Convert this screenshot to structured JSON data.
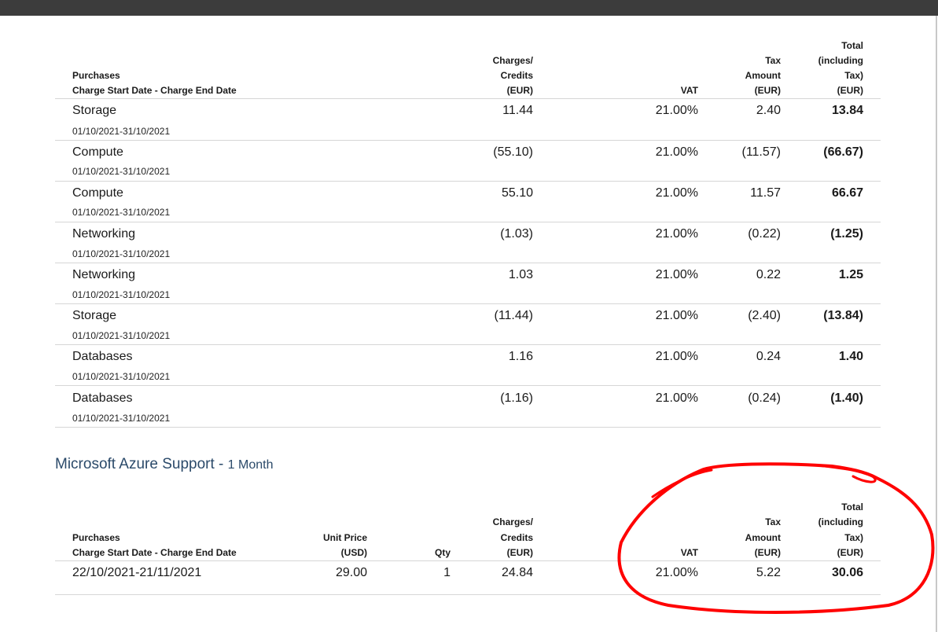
{
  "table1": {
    "headers": {
      "purchases": "Purchases",
      "dates": "Charge Start Date - Charge End Date",
      "charges": [
        "Charges/",
        "Credits",
        "(EUR)"
      ],
      "vat": "VAT",
      "tax": [
        "Tax",
        "Amount",
        "(EUR)"
      ],
      "total": [
        "Total",
        "(including",
        "Tax)",
        "(EUR)"
      ]
    },
    "rows": [
      {
        "name": "Storage",
        "dates": "01/10/2021-31/10/2021",
        "charges": "11.44",
        "vat": "21.00%",
        "tax": "2.40",
        "total": "13.84"
      },
      {
        "name": "Compute",
        "dates": "01/10/2021-31/10/2021",
        "charges": "(55.10)",
        "vat": "21.00%",
        "tax": "(11.57)",
        "total": "(66.67)"
      },
      {
        "name": "Compute",
        "dates": "01/10/2021-31/10/2021",
        "charges": "55.10",
        "vat": "21.00%",
        "tax": "11.57",
        "total": "66.67"
      },
      {
        "name": "Networking",
        "dates": "01/10/2021-31/10/2021",
        "charges": "(1.03)",
        "vat": "21.00%",
        "tax": "(0.22)",
        "total": "(1.25)"
      },
      {
        "name": "Networking",
        "dates": "01/10/2021-31/10/2021",
        "charges": "1.03",
        "vat": "21.00%",
        "tax": "0.22",
        "total": "1.25"
      },
      {
        "name": "Storage",
        "dates": "01/10/2021-31/10/2021",
        "charges": "(11.44)",
        "vat": "21.00%",
        "tax": "(2.40)",
        "total": "(13.84)"
      },
      {
        "name": "Databases",
        "dates": "01/10/2021-31/10/2021",
        "charges": "1.16",
        "vat": "21.00%",
        "tax": "0.24",
        "total": "1.40"
      },
      {
        "name": "Databases",
        "dates": "01/10/2021-31/10/2021",
        "charges": "(1.16)",
        "vat": "21.00%",
        "tax": "(0.24)",
        "total": "(1.40)"
      }
    ]
  },
  "section2": {
    "title": "Microsoft Azure Support",
    "separator": " - ",
    "subtitle": "1 Month"
  },
  "table2": {
    "headers": {
      "purchases": "Purchases",
      "dates": "Charge Start Date - Charge End Date",
      "unit_price": [
        "Unit Price",
        "(USD)"
      ],
      "qty": "Qty",
      "charges": [
        "Charges/",
        "Credits",
        "(EUR)"
      ],
      "vat": "VAT",
      "tax": [
        "Tax",
        "Amount",
        "(EUR)"
      ],
      "total": [
        "Total",
        "(including",
        "Tax)",
        "(EUR)"
      ]
    },
    "row": {
      "dates": "22/10/2021-21/11/2021",
      "unit_price": "29.00",
      "qty": "1",
      "charges": "24.84",
      "vat": "21.00%",
      "tax": "5.22",
      "total": "30.06"
    }
  },
  "annotation": {
    "color": "#ff0000"
  }
}
